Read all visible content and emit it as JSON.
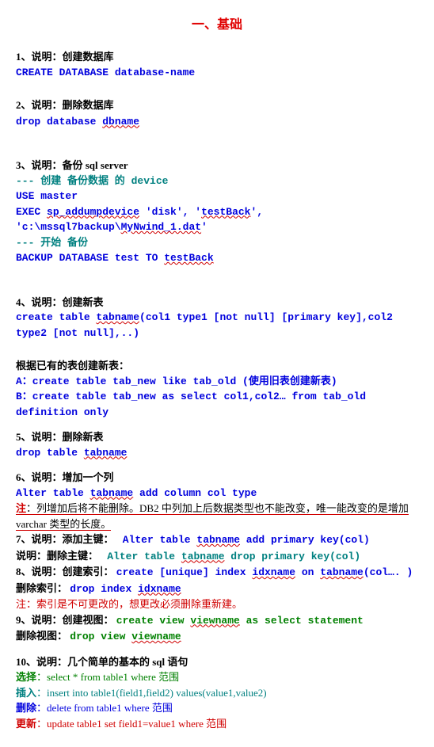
{
  "title": "一、基础",
  "s1": {
    "h": "1、说明：创建数据库",
    "l1": "CREATE DATABASE database-name"
  },
  "s2": {
    "h": "2、说明：删除数据库",
    "l1_a": "drop database ",
    "l1_b": "dbname"
  },
  "s3": {
    "h": "3、说明：备份 sql server",
    "c1": "--- 创建 备份数据 的 device",
    "l1": "USE master",
    "l2_a": "EXEC ",
    "l2_b": "sp_addumpdevice",
    "l2_c": " 'disk', '",
    "l2_d": "testBack",
    "l2_e": "', 'c:\\mssql7backup\\",
    "l2_f": "MyNwind_1.dat",
    "l2_g": "'",
    "c2": "--- 开始 备份",
    "l3_a": "BACKUP DATABASE test TO ",
    "l3_b": "testBack"
  },
  "s4": {
    "h": "4、说明：创建新表",
    "l1_a": "create table ",
    "l1_b": "tabname",
    "l1_c": "(col1 type1 [not null] [primary key],col2 type2 [not null],..)",
    "h2": "根据已有的表创建新表：",
    "la": "A：create table tab_new like tab_old (使用旧表创建新表)",
    "lb": "B：create table tab_new as select col1,col2… from tab_old definition only"
  },
  "s5": {
    "h": "5、说明：删除新表",
    "l1_a": "drop table ",
    "l1_b": "tabname"
  },
  "s6": {
    "h": "6、说明：增加一个列",
    "l1_a": "Alter table ",
    "l1_b": "tabname",
    "l1_c": " add column col type",
    "note_p": "注",
    "note_t": "：列增加后将不能删除。DB2 中列加上后数据类型也不能改变，唯一能改变的是增加 varchar 类型的长度。"
  },
  "s7": {
    "h": "7、说明：添加主键：",
    "l1_a": "Alter table ",
    "l1_b": "tabname",
    "l1_c": " add primary key(col)",
    "h2": "说明：删除主键：",
    "l2_a": "Alter table ",
    "l2_b": "tabname",
    "l2_c": " drop primary key(col)"
  },
  "s8": {
    "h": "8、说明：创建索引：",
    "l1_a": "create [unique] index ",
    "l1_b": "idxname",
    "l1_c": " on ",
    "l1_d": "tabname",
    "l1_e": "(col…. )",
    "h2": "删除索引：",
    "l2_a": "drop index ",
    "l2_b": "idxname",
    "note": "注：索引是不可更改的，想更改必须删除重新建。"
  },
  "s9": {
    "h": "9、说明：创建视图：",
    "l1_a": "create view ",
    "l1_b": "viewname",
    "l1_c": " as select statement",
    "h2": "删除视图：",
    "l2_a": "drop view ",
    "l2_b": "viewname"
  },
  "s10": {
    "h": "10、说明：几个简单的基本的 sql 语句",
    "sel_h": "选择",
    "sel_c": "：select * from table1 where 范围",
    "ins_h": "插入",
    "ins_c": "：insert into table1(field1,field2) values(value1,value2)",
    "del_h": "删除",
    "del_c": "：delete from table1 where 范围",
    "upd_h": "更新",
    "upd_c": "：update table1 set field1=value1 where 范围"
  }
}
